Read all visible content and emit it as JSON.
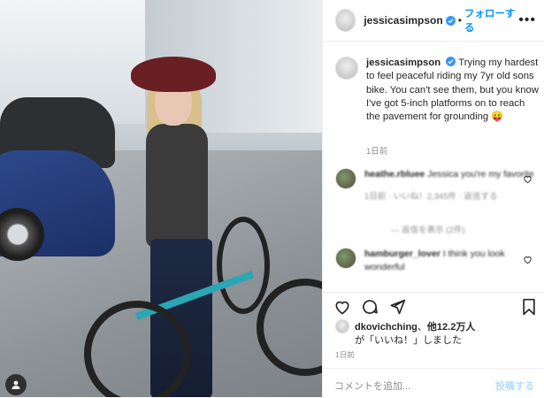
{
  "post": {
    "username": "jessicasimpson",
    "follow_label": "フォローする",
    "dot": "•",
    "more_icon": "more-horizontal-icon",
    "caption": "Trying my hardest to feel peaceful riding my 7yr old sons bike. You can't see them, but you know I've got 5-inch platforms on to reach the pavement for grounding 😛",
    "caption_time": "1日前"
  },
  "comments": [
    {
      "username": "heathe.rbluee",
      "text": "Jessica you're my favorite",
      "view_replies": "— 返信を表示 (2件)"
    },
    {
      "username": "hamburger_lover",
      "text": "I think you look wonderful",
      "view_replies": ""
    }
  ],
  "likes": {
    "liker": "dkovichching",
    "count_text": "他12.2万人",
    "suffix": "が「いいね！」しました"
  },
  "post_time": "1日前",
  "composer": {
    "placeholder": "コメントを追加...",
    "post_label": "投稿する"
  },
  "colors": {
    "accent": "#0095f6",
    "muted": "#8e8e8e",
    "verified": "#3897f0"
  }
}
